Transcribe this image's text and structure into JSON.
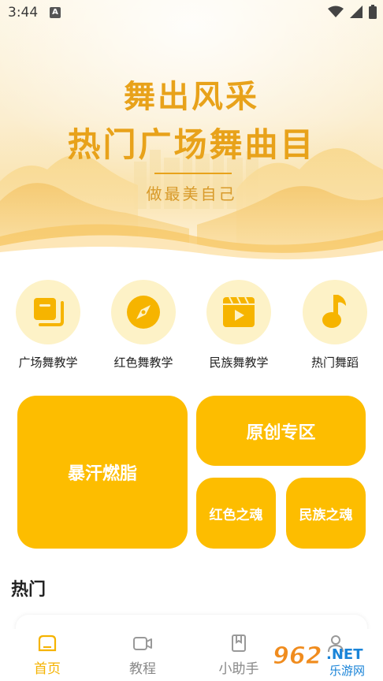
{
  "status_bar": {
    "time": "3:44",
    "notification_glyph": "A",
    "icons": [
      "wifi-icon",
      "signal-icon",
      "battery-icon"
    ]
  },
  "banner": {
    "title_line1": "舞出风采",
    "title_line2": "热门广场舞曲目",
    "subtitle": "做最美自己"
  },
  "categories": [
    {
      "label": "广场舞教学",
      "icon": "copy-icon"
    },
    {
      "label": "红色舞教学",
      "icon": "compass-icon"
    },
    {
      "label": "民族舞教学",
      "icon": "video-icon"
    },
    {
      "label": "热门舞蹈",
      "icon": "music-note-icon"
    }
  ],
  "tiles": {
    "big": "暴汗燃脂",
    "wide": "原创专区",
    "small1": "红色之魂",
    "small2": "民族之魂"
  },
  "section": {
    "hot_title": "热门"
  },
  "bottom_nav": [
    {
      "label": "首页",
      "icon": "home-icon",
      "active": true
    },
    {
      "label": "教程",
      "icon": "video-camera-icon",
      "active": false
    },
    {
      "label": "小助手",
      "icon": "bookmark-icon",
      "active": false
    },
    {
      "label": "",
      "icon": "user-icon",
      "active": false
    }
  ],
  "watermark": {
    "brand": "962",
    "suffix": ".NET",
    "caption": "乐游网"
  },
  "colors": {
    "accent": "#fdbd00",
    "banner_text": "#e8a21a",
    "icon_circle": "#fdf2c7",
    "nav_active": "#f5b300",
    "nav_inactive": "#888888"
  }
}
